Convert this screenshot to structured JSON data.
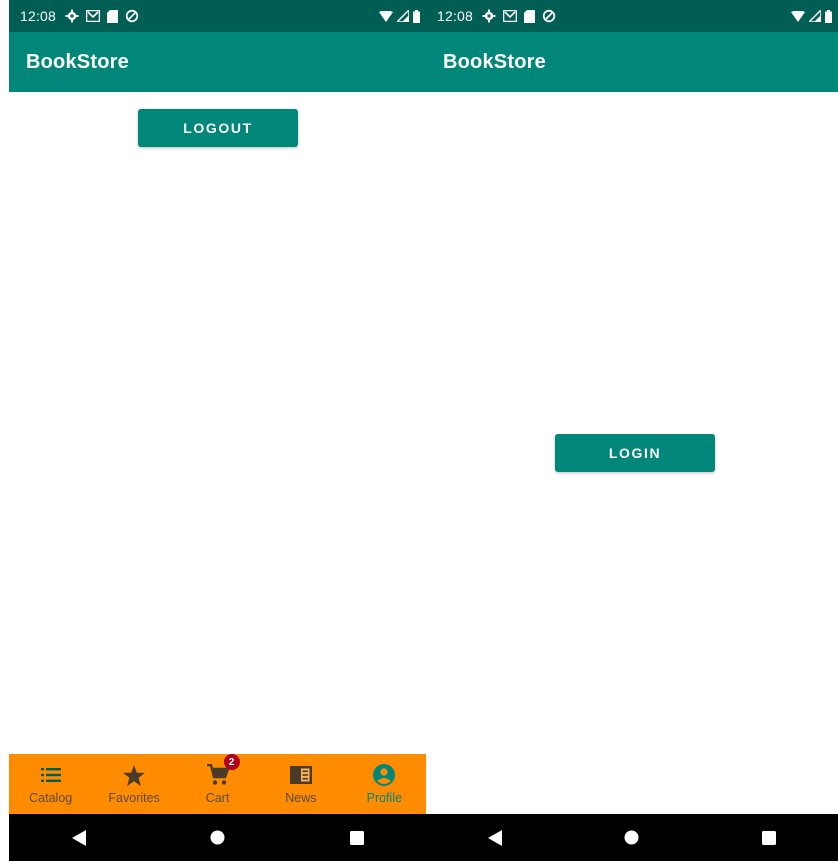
{
  "left_screen": {
    "status_bar": {
      "time": "12:08"
    },
    "app_bar": {
      "title": "BookStore"
    },
    "logout_button": {
      "label": "LOGOUT"
    },
    "bottom_nav": {
      "items": [
        {
          "label": "Catalog",
          "icon": "list-icon"
        },
        {
          "label": "Favorites",
          "icon": "star-icon"
        },
        {
          "label": "Cart",
          "icon": "cart-icon",
          "badge": "2"
        },
        {
          "label": "News",
          "icon": "newspaper-icon"
        },
        {
          "label": "Profile",
          "icon": "account-circle-icon",
          "active": true
        }
      ]
    }
  },
  "right_screen": {
    "status_bar": {
      "time": "12:08"
    },
    "app_bar": {
      "title": "BookStore"
    },
    "login_button": {
      "label": "LOGIN"
    }
  },
  "colors": {
    "status_bar": "#005e55",
    "app_bar": "#00877a",
    "accent": "#00877a",
    "bottom_nav_bg": "#ff8c00",
    "badge": "#b0001c",
    "system_nav_bg": "#000000"
  }
}
